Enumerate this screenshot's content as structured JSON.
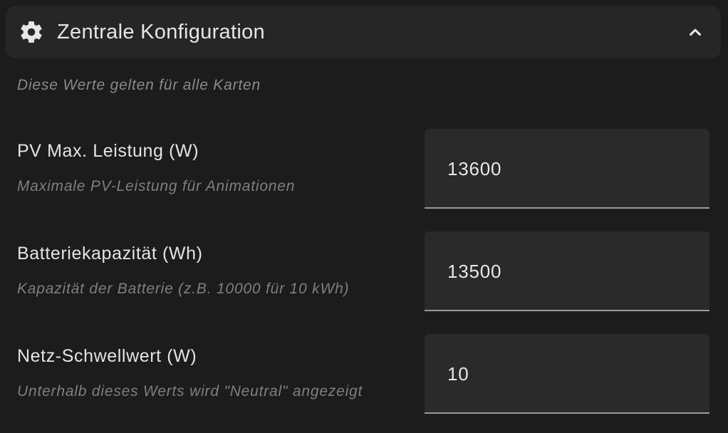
{
  "header": {
    "title": "Zentrale Konfiguration",
    "icon": "gear-icon",
    "toggle_icon": "chevron-up-icon"
  },
  "subtitle": "Diese Werte gelten für alle Karten",
  "fields": [
    {
      "label": "PV Max. Leistung (W)",
      "description": "Maximale PV-Leistung für Animationen",
      "value": "13600"
    },
    {
      "label": "Batteriekapazität (Wh)",
      "description": "Kapazität der Batterie (z.B. 10000 für 10 kWh)",
      "value": "13500"
    },
    {
      "label": "Netz-Schwellwert (W)",
      "description": "Unterhalb dieses Werts wird \"Neutral\" angezeigt",
      "value": "10"
    }
  ],
  "colors": {
    "background": "#1c1c1c",
    "header_background": "#262626",
    "field_background": "#2a2a2a",
    "text_primary": "#e4e4e4",
    "text_secondary": "#7f7f7f"
  }
}
